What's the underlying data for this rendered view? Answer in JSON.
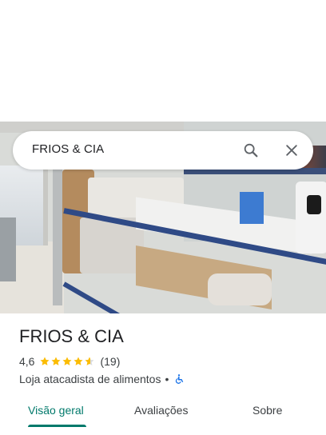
{
  "search": {
    "query": "FRIOS & CIA",
    "search_icon": "search-icon",
    "close_icon": "close-icon"
  },
  "place": {
    "name": "FRIOS & CIA",
    "rating": "4,6",
    "rating_value": 4.6,
    "stars_max": 5,
    "review_count": "(19)",
    "category": "Loja atacadista de alimentos",
    "separator": "•",
    "accessibility_icon": "wheelchair-accessible-icon"
  },
  "tabs": [
    {
      "label": "Visão geral",
      "active": true
    },
    {
      "label": "Avaliações",
      "active": false
    },
    {
      "label": "Sobre",
      "active": false
    }
  ],
  "colors": {
    "accent": "#00796b",
    "star": "#fbbc04",
    "star_empty": "#dadce0",
    "accessibility": "#1a73e8",
    "text_primary": "#202124",
    "text_secondary": "#3c4043"
  }
}
